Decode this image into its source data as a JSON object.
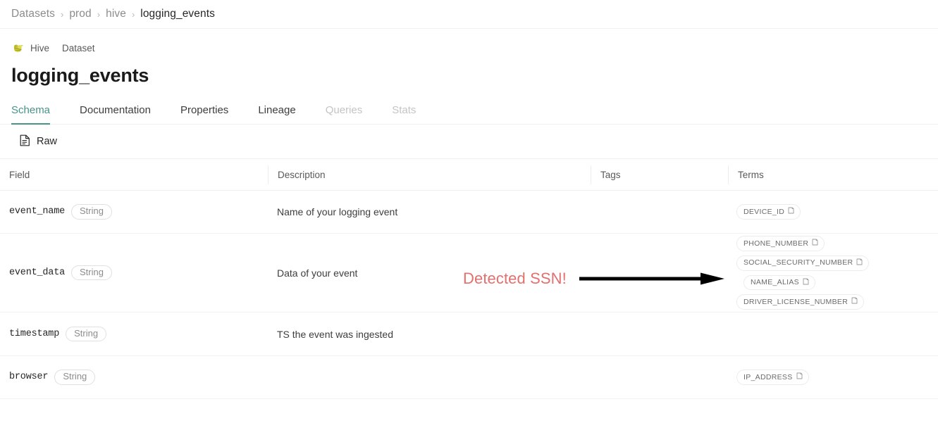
{
  "breadcrumb": {
    "separator": "›",
    "items": [
      {
        "label": "Datasets"
      },
      {
        "label": "prod"
      },
      {
        "label": "hive"
      },
      {
        "label": "logging_events"
      }
    ]
  },
  "header": {
    "platform_icon": "hive-logo-icon",
    "platform": "Hive",
    "entity_type": "Dataset",
    "title": "logging_events"
  },
  "tabs": [
    {
      "label": "Schema",
      "state": "active"
    },
    {
      "label": "Documentation",
      "state": "enabled"
    },
    {
      "label": "Properties",
      "state": "enabled"
    },
    {
      "label": "Lineage",
      "state": "enabled"
    },
    {
      "label": "Queries",
      "state": "disabled"
    },
    {
      "label": "Stats",
      "state": "disabled"
    }
  ],
  "subbar": {
    "raw_label": "Raw",
    "raw_icon": "file-text-icon"
  },
  "table": {
    "columns": [
      {
        "key": "field",
        "label": "Field"
      },
      {
        "key": "description",
        "label": "Description"
      },
      {
        "key": "tags",
        "label": "Tags"
      },
      {
        "key": "terms",
        "label": "Terms"
      }
    ],
    "rows": [
      {
        "field": "event_name",
        "type": "String",
        "description": "Name of your logging event",
        "tags": [],
        "terms": [
          {
            "label": "DEVICE_ID",
            "icon": "book-icon"
          }
        ]
      },
      {
        "field": "event_data",
        "type": "String",
        "description": "Data of your event",
        "tags": [],
        "terms": [
          {
            "label": "PHONE_NUMBER",
            "icon": "book-icon"
          },
          {
            "label": "SOCIAL_SECURITY_NUMBER",
            "icon": "book-icon"
          },
          {
            "label": "NAME_ALIAS",
            "icon": "book-icon"
          },
          {
            "label": "DRIVER_LICENSE_NUMBER",
            "icon": "book-icon"
          }
        ]
      },
      {
        "field": "timestamp",
        "type": "String",
        "description": "TS the event was ingested",
        "tags": [],
        "terms": []
      },
      {
        "field": "browser",
        "type": "String",
        "description": "",
        "tags": [],
        "terms": [
          {
            "label": "IP_ADDRESS",
            "icon": "book-icon"
          }
        ]
      }
    ]
  },
  "annotation": {
    "text": "Detected SSN!",
    "color": "#e2706e",
    "arrow_icon": "right-arrow-icon"
  },
  "colors": {
    "accent": "#47938c",
    "annotation_red": "#e2706e",
    "border": "#f0f0f0",
    "text_primary": "#262626",
    "text_muted": "#8c8c8c"
  }
}
